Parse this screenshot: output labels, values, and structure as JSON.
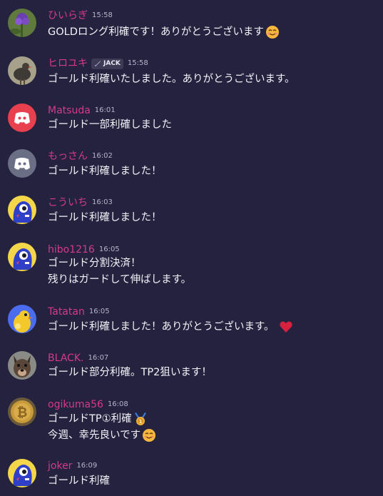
{
  "messages": [
    {
      "author": "ひいらぎ",
      "time": "15:58",
      "avatar": "flower-photo-avatar",
      "lines": [
        "GOLDロング利確です！ありがとうございます"
      ],
      "emoji": "smiling-face-icon"
    },
    {
      "author": "ヒロユキ",
      "time": "15:58",
      "avatar": "bird-photo-avatar",
      "role_tag": "JACK",
      "lines": [
        "ゴールド利確いたしました。ありがとうございます。"
      ]
    },
    {
      "author": "Matsuda",
      "time": "16:01",
      "avatar": "discord-default-avatar-red",
      "lines": [
        "ゴールド一部利確しました"
      ]
    },
    {
      "author": "もっさん",
      "time": "16:02",
      "avatar": "discord-default-avatar-gray",
      "lines": [
        "ゴールド利確しました！"
      ]
    },
    {
      "author": "こういち",
      "time": "16:03",
      "avatar": "blue-character-avatar",
      "lines": [
        "ゴールド利確しました！"
      ]
    },
    {
      "author": "hibo1216",
      "time": "16:05",
      "avatar": "blue-character-avatar",
      "lines": [
        "ゴールド分割決済！",
        "残りはガードして伸ばします。"
      ]
    },
    {
      "author": "Tatatan",
      "time": "16:05",
      "avatar": "yellow-character-avatar",
      "lines": [
        "ゴールド利確しました！ありがとうございます。"
      ],
      "emoji": "red-heart-icon"
    },
    {
      "author": "BLACK.",
      "time": "16:07",
      "avatar": "dog-photo-avatar",
      "lines": [
        "ゴールド部分利確。TP2狙います！"
      ]
    },
    {
      "author": "ogikuma56",
      "time": "16:08",
      "avatar": "bitcoin-coin-avatar",
      "lines": [
        "ゴールドTP①利確",
        "今週、幸先良いです"
      ],
      "line_emojis": [
        "medal-icon",
        "smiling-face-icon"
      ]
    },
    {
      "author": "joker",
      "time": "16:09",
      "avatar": "blue-character-avatar",
      "lines": [
        "ゴールド利確"
      ]
    }
  ],
  "colors": {
    "background": "#25223f",
    "author_name": "#d43a8a",
    "timestamp": "#b7b4cb",
    "message_text": "#f3f2f8",
    "discord_red": "#e8404e",
    "discord_gray": "#6b6f85"
  }
}
